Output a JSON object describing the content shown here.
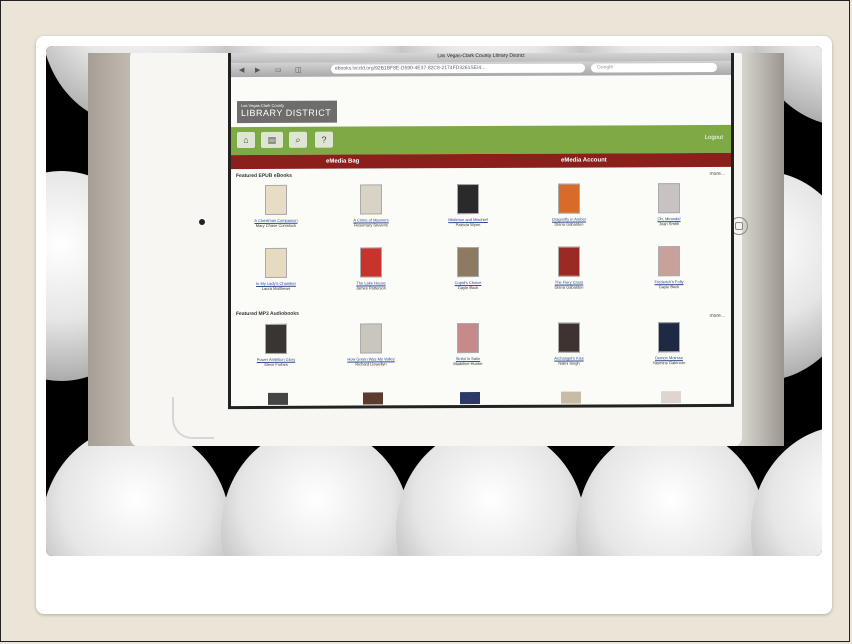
{
  "browser": {
    "title": "Las Vegas-Clark County Library District",
    "url": "ebooks.lvccld.org/92B1BF8E-D590-4E37-82C8-2174FD3261SE/4...",
    "search_placeholder": "Google",
    "back_glyph": "◀",
    "forward_glyph": "▶",
    "bookmarks_glyph": "▭",
    "tabs_glyph": "◫"
  },
  "site": {
    "logo_small": "Las Vegas-Clark County",
    "logo_big": "LIBRARY DISTRICT",
    "logout": "Logout",
    "media_bag": "eMedia Bag",
    "media_account": "eMedia Account",
    "nav_icons": [
      "home-icon",
      "book-icon",
      "search-icon",
      "help-icon"
    ]
  },
  "sections": [
    {
      "heading": "Featured EPUB eBooks",
      "more": "more...",
      "books": [
        {
          "title": "A Christmas Companion",
          "author": "Mary Chase Comstock",
          "color": "#e8dcc4"
        },
        {
          "title": "A Crime of Manners",
          "author": "Rosemary Stevens",
          "color": "#d8d3c5"
        },
        {
          "title": "Mistletoe and Mischief",
          "author": "Patricia Wynn",
          "color": "#2a2a2a"
        },
        {
          "title": "Dragonfly in Amber",
          "author": "Diana Gabaldon",
          "color": "#d86a2a"
        },
        {
          "title": "Oh, Miranda!",
          "author": "Joan Smith",
          "color": "#c9c2c2"
        },
        {
          "title": "In My Lady's Chamber",
          "author": "Laura Matthews",
          "color": "#e6dac0"
        },
        {
          "title": "The Lake House",
          "author": "James Patterson",
          "color": "#c8332b"
        },
        {
          "title": "Cupid's Choice",
          "author": "Gayle Buck",
          "color": "#8d7a62"
        },
        {
          "title": "The Fiery Cross",
          "author": "Diana Gabaldon",
          "color": "#9b2a22"
        },
        {
          "title": "Frederick's Folly",
          "author": "Gayle Buck",
          "color": "#caa19a"
        }
      ]
    },
    {
      "heading": "Featured MP3 Audiobooks",
      "more": "more...",
      "books": [
        {
          "title": "Power Ambition Glory",
          "author": "Steve Forbes",
          "color": "#3a3530"
        },
        {
          "title": "How Green Was My Valley",
          "author": "Richard Llewellyn",
          "color": "#c9c6bd"
        },
        {
          "title": "Sinful in Satin",
          "author": "Madeline Hunter",
          "color": "#c78a8a"
        },
        {
          "title": "Archangel's Kiss",
          "author": "Nalini Singh",
          "color": "#3e3330"
        },
        {
          "title": "Demon Moirsso",
          "author": "Yasmine Galenorn",
          "color": "#1e2a44"
        }
      ]
    }
  ]
}
